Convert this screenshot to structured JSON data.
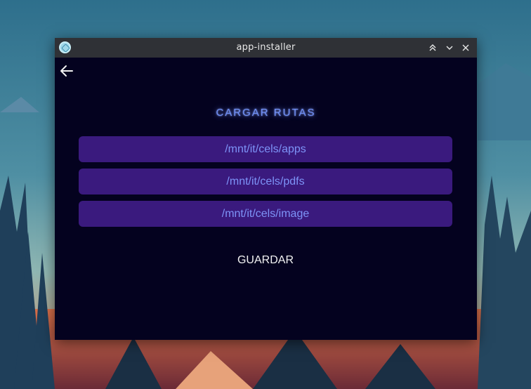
{
  "window": {
    "title": "app-installer",
    "icon": "app-installer-icon",
    "controls": [
      "keep-above-icon",
      "minimize-icon",
      "close-icon"
    ]
  },
  "screen": {
    "back_icon": "arrow-left-icon",
    "heading": "CARGAR RUTAS",
    "paths": [
      {
        "value": "/mnt/it/cels/apps"
      },
      {
        "value": "/mnt/it/cels/pdfs"
      },
      {
        "value": "/mnt/it/cels/image"
      }
    ],
    "save_label": "GUARDAR"
  },
  "colors": {
    "window_bg": "#04021f",
    "titlebar_bg": "#2f3136",
    "path_item_bg": "#3a1a7e",
    "path_text": "#7d93f7",
    "heading": "#6f8ff5",
    "save_text": "#f2f2f2"
  }
}
